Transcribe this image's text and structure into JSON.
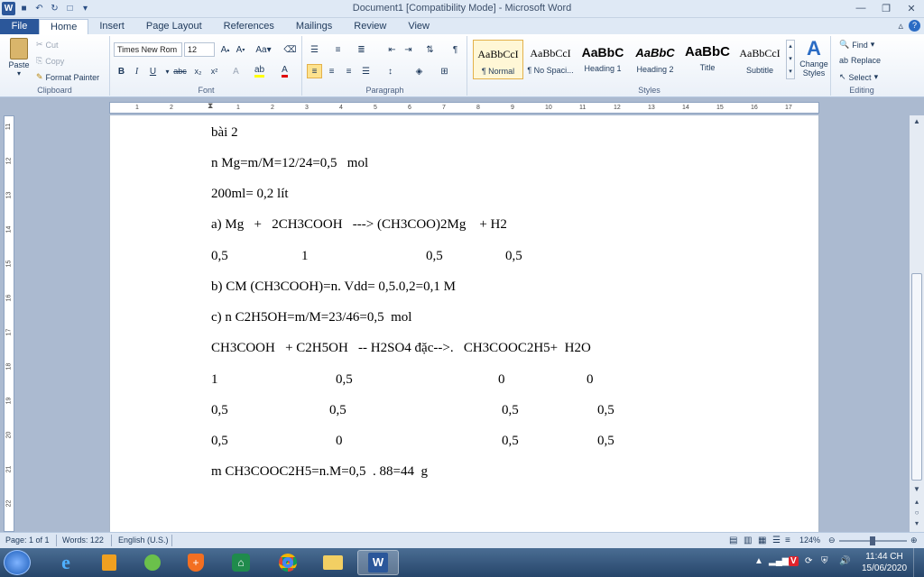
{
  "window": {
    "title": "Document1 [Compatibility Mode] - Microsoft Word"
  },
  "tabs": [
    {
      "label": "File"
    },
    {
      "label": "Home"
    },
    {
      "label": "Insert"
    },
    {
      "label": "Page Layout"
    },
    {
      "label": "References"
    },
    {
      "label": "Mailings"
    },
    {
      "label": "Review"
    },
    {
      "label": "View"
    }
  ],
  "clipboard": {
    "paste": "Paste",
    "cut": "Cut",
    "copy": "Copy",
    "format_painter": "Format Painter",
    "label": "Clipboard"
  },
  "font": {
    "name": "Times New Rom",
    "size": "12",
    "label": "Font"
  },
  "paragraph": {
    "label": "Paragraph"
  },
  "styles": {
    "items": [
      {
        "preview": "AaBbCcI",
        "name": "¶ Normal"
      },
      {
        "preview": "AaBbCcI",
        "name": "¶ No Spaci..."
      },
      {
        "preview": "AaBbC",
        "name": "Heading 1"
      },
      {
        "preview": "AaBbC",
        "name": "Heading 2"
      },
      {
        "preview": "AaBbC",
        "name": "Title"
      },
      {
        "preview": "AaBbCcI",
        "name": "Subtitle"
      }
    ],
    "change_styles": "Change Styles",
    "label": "Styles"
  },
  "editing": {
    "find": "Find",
    "replace": "Replace",
    "select": "Select",
    "label": "Editing"
  },
  "ruler": {
    "ticks": [
      "1",
      "2",
      "1",
      "2",
      "3",
      "4",
      "5",
      "6",
      "7",
      "8",
      "9",
      "10",
      "11",
      "12",
      "13",
      "14",
      "15",
      "16",
      "17"
    ]
  },
  "left_ruler": {
    "ticks": [
      "11",
      "12",
      "13",
      "14",
      "15",
      "16",
      "17",
      "18",
      "19",
      "20",
      "21",
      "22"
    ]
  },
  "document": {
    "lines": [
      "bài 2",
      "n Mg=m/M=12/24=0,5   mol",
      "200ml= 0,2 lít",
      "a) Mg   +   2CH3COOH   ---> (CH3COO)2Mg    + H2",
      "b) CM (CH3COOH)=n. Vdd= 0,5.0,2=0,1 M",
      "c) n C2H5OH=m/M=23/46=0,5  mol",
      "CH3COOH   + C2H5OH   -- H2SO4 đặc-->.   CH3COOC2H5+  H2O",
      "m CH3COOC2H5=n.M=0,5  . 88=44  g"
    ],
    "rows": [
      [
        "0,5",
        "1",
        "0,5",
        "0,5"
      ],
      [
        "1",
        "0,5",
        "0",
        "0"
      ],
      [
        "0,5",
        "0,5",
        "0,5",
        "0,5"
      ],
      [
        "0,5",
        "0",
        "0,5",
        "0,5"
      ]
    ]
  },
  "status": {
    "page": "Page: 1 of 1",
    "words": "Words: 122",
    "language": "English (U.S.)",
    "zoom": "124%"
  },
  "clock": {
    "time": "11:44 CH",
    "date": "15/06/2020"
  },
  "colors": {
    "accent": "#2b579a",
    "ribbon_bg": "#dfe9f5",
    "taskbar": "#26456a"
  }
}
